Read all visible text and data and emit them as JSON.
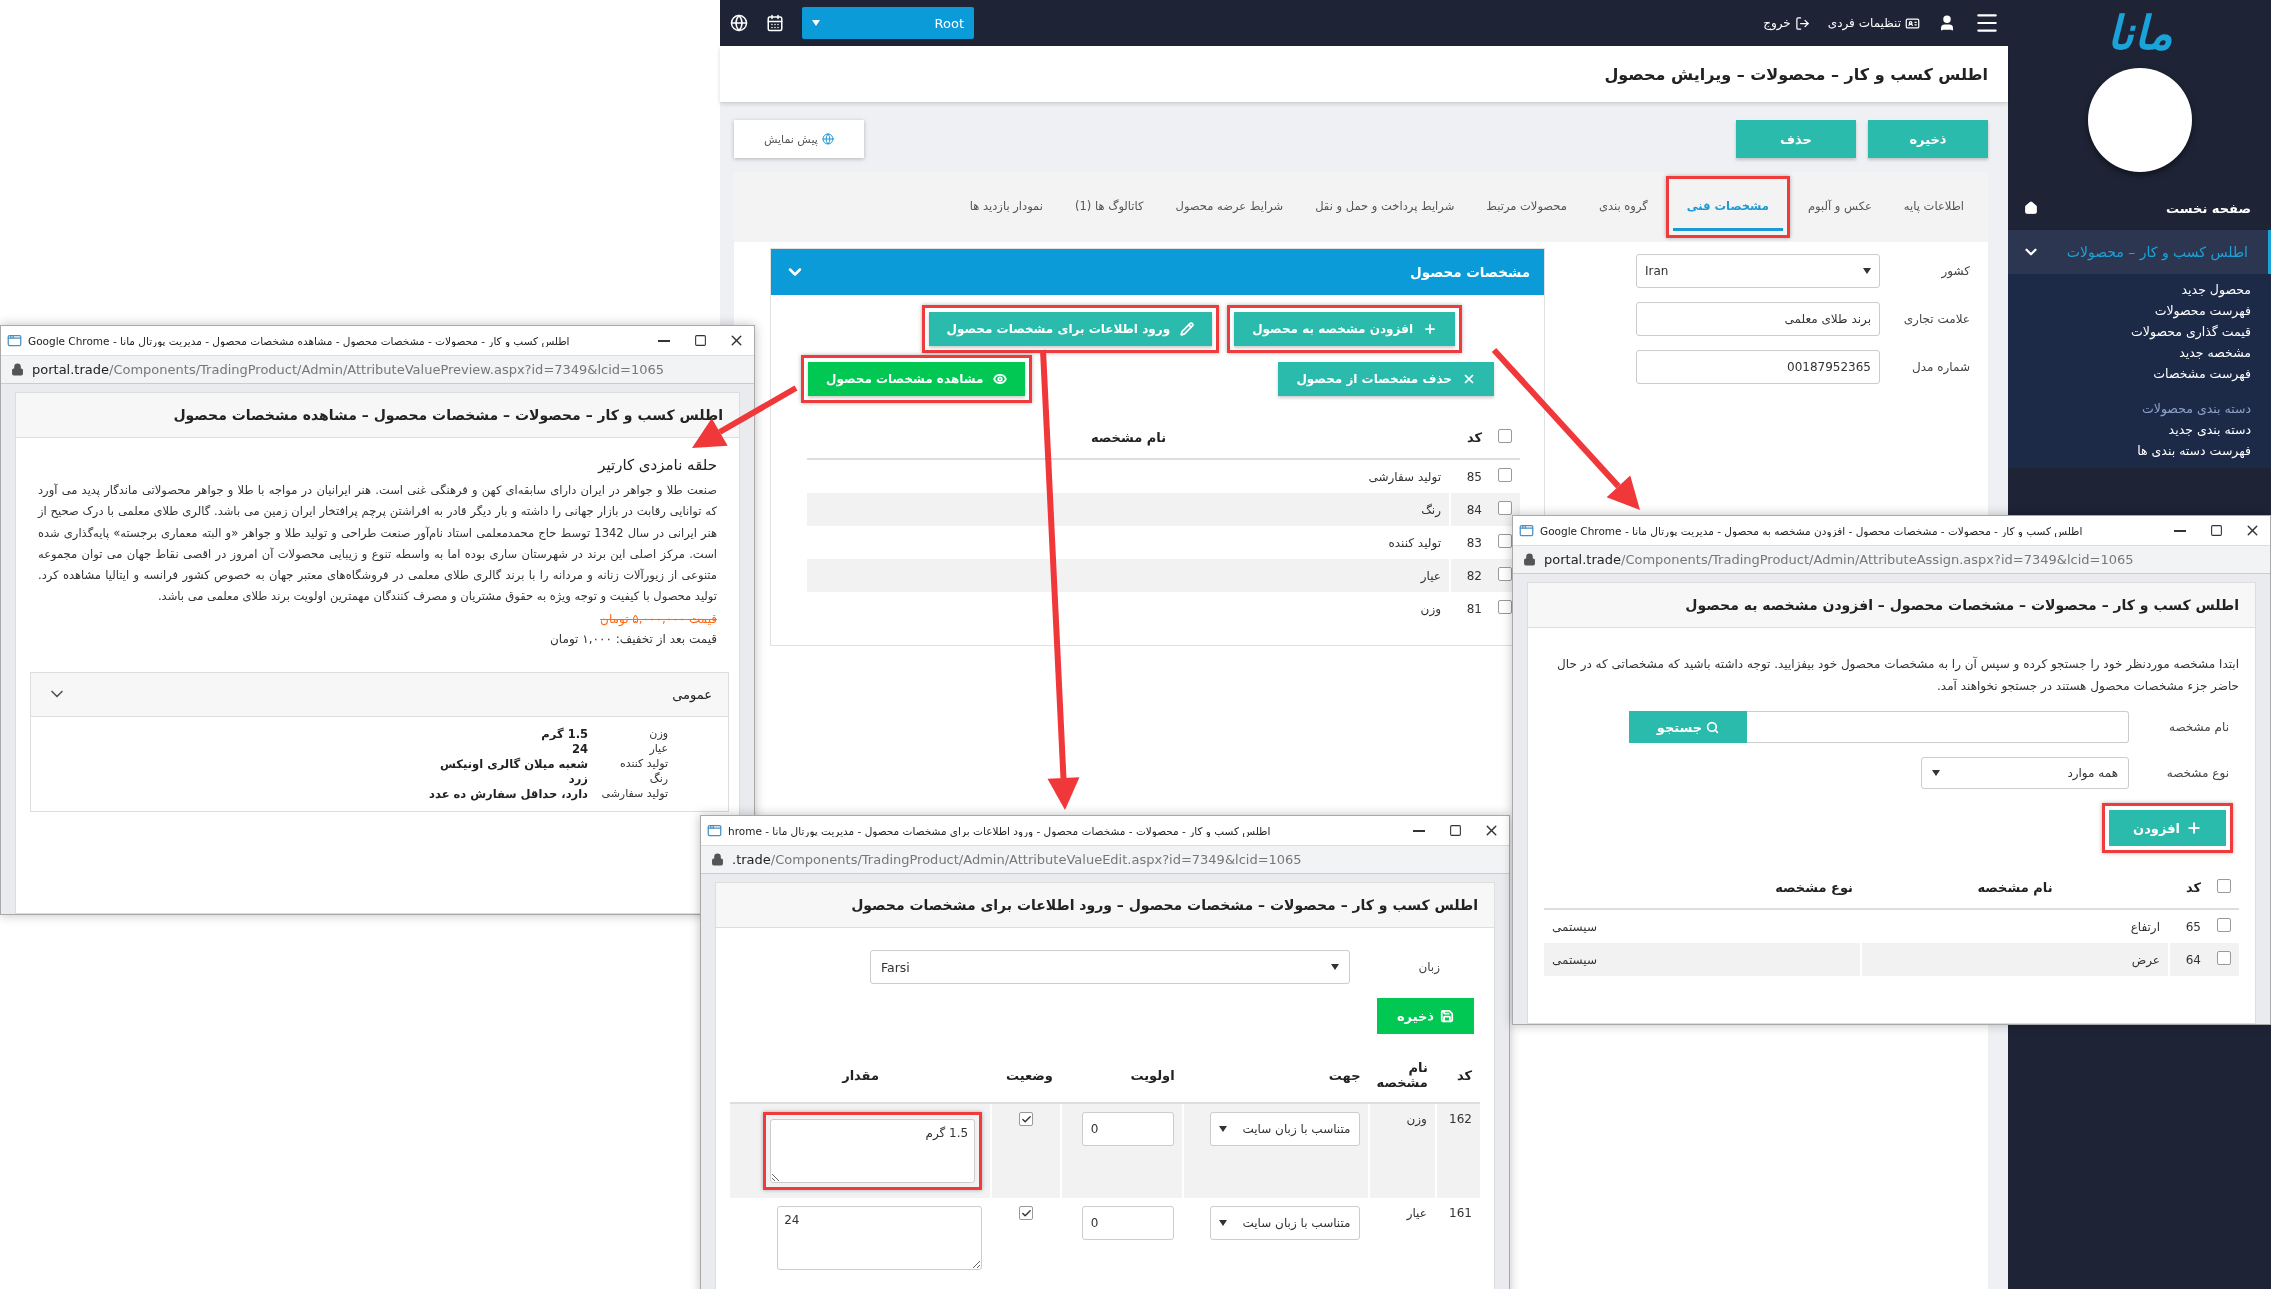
{
  "main": {
    "topbar": {
      "root_select": "Root",
      "settings": "تنظیمات فردی",
      "logout": "خروج"
    },
    "sidebar": {
      "logo": "مانا",
      "home": "صفحه نخست",
      "section": {
        "label": "اطلس کسب و کار – محصولات",
        "expanded": true
      },
      "items": [
        {
          "label": "محصول جدید",
          "kind": "link"
        },
        {
          "label": "فهرست محصولات",
          "kind": "link"
        },
        {
          "label": "قیمت گذاری محصولات",
          "kind": "link"
        },
        {
          "label": "مشخصه جدید",
          "kind": "link"
        },
        {
          "label": "فهرست مشخصات",
          "kind": "link"
        },
        {
          "label": "دسته بندی محصولات",
          "kind": "heading"
        },
        {
          "label": "دسته بندی جدید",
          "kind": "link"
        },
        {
          "label": "فهرست دسته بندی ها",
          "kind": "link"
        }
      ]
    },
    "page_title": "اطلس کسب و کار – محصولات – ویرایش محصول",
    "actions": [
      {
        "label": "ذخیره"
      },
      {
        "label": "حذف"
      }
    ],
    "preview_button": "پیش نمایش",
    "tabs": [
      {
        "label": "اطلاعات پایه",
        "selected": false,
        "highlighted": false
      },
      {
        "label": "عکس و آلبوم",
        "selected": false,
        "highlighted": false
      },
      {
        "label": "مشخصات فنی",
        "selected": true,
        "highlighted": true
      },
      {
        "label": "گروه بندی",
        "selected": false,
        "highlighted": false
      },
      {
        "label": "محصولات مرتبط",
        "selected": false,
        "highlighted": false
      },
      {
        "label": "شرایط پرداخت و حمل و نقل",
        "selected": false,
        "highlighted": false
      },
      {
        "label": "شرایط عرضه محصول",
        "selected": false,
        "highlighted": false
      },
      {
        "label": "کاتالوگ ها (1)",
        "selected": false,
        "highlighted": false
      },
      {
        "label": "نمودار بازدید ها",
        "selected": false,
        "highlighted": false
      }
    ],
    "panel": {
      "title": "مشخصات محصول",
      "expanded": true,
      "buttons": [
        {
          "label": "افزودن مشخصه به محصول",
          "kind": "add",
          "highlighted": true
        },
        {
          "label": "ورود اطلاعات برای مشخصات محصول",
          "kind": "edit",
          "highlighted": true
        },
        {
          "label": "حذف مشخصات از محصول",
          "kind": "remove",
          "highlighted": false
        },
        {
          "label": "مشاهده مشخصات محصول",
          "kind": "view",
          "highlighted": true
        }
      ],
      "table": {
        "columns": [
          "کد",
          "نام مشخصه"
        ],
        "header_checked": false,
        "rows": [
          {
            "code": "85",
            "name": "تولید سفارشی",
            "checked": false
          },
          {
            "code": "84",
            "name": "رنگ",
            "checked": false
          },
          {
            "code": "83",
            "name": "تولید کننده",
            "checked": false
          },
          {
            "code": "82",
            "name": "عیار",
            "checked": false
          },
          {
            "code": "81",
            "name": "وزن",
            "checked": false
          }
        ]
      }
    },
    "fields": [
      {
        "label": "کشور",
        "value": "Iran",
        "kind": "select"
      },
      {
        "label": "علامت تجاری",
        "value": "برند طلای معلمی",
        "kind": "text"
      },
      {
        "label": "شماره مدل",
        "value": "00187952365",
        "kind": "text"
      }
    ]
  },
  "preview_window": {
    "title": "اطلس کسب و کار - محصولات - مشخصات محصول - مشاهده مشخصات محصول - مدیریت پورتال مانا - Google Chrome",
    "url_host": "portal.trade",
    "url_path": "/Components/TradingProduct/Admin/AttributeValuePreview.aspx?id=7349&lcid=1065",
    "page_title": "اطلس کسب و کار – محصولات – مشخصات محصول – مشاهده مشخصات محصول",
    "product_title": "حلقه نامزدی کارتیر",
    "description": "صنعت طلا و جواهر در ایران دارای سابقه‌ای کهن و فرهنگی غنی است. هنر ایرانیان در مواجه با طلا و جواهر محصولاتی ماندگار پدید می آورد که توانایی رقابت در بازار جهانی را داشته و بار دیگر قادر به افراشتن پرچم پرافتخار ایران زمین می باشد. گالری طلای معلمی با درک صحیح از هنر ایرانی در سال 1342 توسط حاج محمدمعلمی استاد نام‌آور صنعت طراحی و تولید طلا و جواهر «و البته معماری برجسته» پایه‌گذاری شده است. مرکز اصلی این برند در شهرستان ساری بوده اما به واسطه تنوع و زیبایی محصولات آن امروز در اقصی نقاط جهان می توان مجموعه متنوعی از زیورآلات زنانه و مردانه را با برند گالری طلای معلمی در فروشگاه‌های معتبر جهان به خصوص کشور فرانسه و ایتالیا مشاهده کرد. تولید محصول با کیفیت و توجه ویژه به حقوق مشتریان و مصرف کنندگان مهمترین اولویت برند طلای معلمی می باشد.",
    "old_price": "قیمت ۵,۰۰۰,۰۰۰ تومان",
    "discounted_price": "قیمت بعد از تخفیف: ۱,۰۰۰ تومان",
    "accordion": {
      "title": "عمومی",
      "expanded": true,
      "rows": [
        {
          "label": "وزن",
          "value": "1.5 گرم"
        },
        {
          "label": "عیار",
          "value": "24"
        },
        {
          "label": "تولید کننده",
          "value": "شعبه میلان گالری اونیکس"
        },
        {
          "label": "رنگ",
          "value": "زرد"
        },
        {
          "label": "تولید سفارشی",
          "value": "دارد، حداقل سفارش ده عدد"
        }
      ]
    }
  },
  "assign_window": {
    "title": "اطلس کسب و کار - محصولات - مشخصات محصول - افزودن مشخصه به محصول - مدیریت پورتال مانا - Google Chrome",
    "url_host": "portal.trade",
    "url_path": "/Components/TradingProduct/Admin/AttributeAssign.aspx?id=7349&lcid=1065",
    "page_title": "اطلس کسب و کار – محصولات – مشخصات محصول – افزودن مشخصه به محصول",
    "instructions": "ابتدا مشخصه موردنظر خود را جستجو کرده و سپس آن را به مشخصات محصول خود بیفزایید. توجه داشته باشید که مشخصاتی که در حال حاضر جزء مشخصات محصول هستند در جستجو نخواهند آمد.",
    "name_label": "نام مشخصه",
    "search_button": "جستجو",
    "type_label": "نوع مشخصه",
    "type_value": "همه موارد",
    "add_button": {
      "label": "افزودن",
      "highlighted": true
    },
    "table": {
      "columns": [
        "کد",
        "نام مشخصه",
        "نوع مشخصه"
      ],
      "header_checked": false,
      "rows": [
        {
          "code": "65",
          "name": "ارتفاع",
          "type": "سیستمی",
          "checked": false
        },
        {
          "code": "64",
          "name": "عرض",
          "type": "سیستمی",
          "checked": false
        }
      ]
    }
  },
  "edit_window": {
    "title": "اطلس کسب و کار - محصولات - مشخصات محصول - ورود اطلاعات برای مشخصات محصول - مدیریت پورتال مانا - hrome",
    "url_host": ".trade",
    "url_path": "/Components/TradingProduct/Admin/AttributeValueEdit.aspx?id=7349&lcid=1065",
    "page_title": "اطلس کسب و کار – محصولات – مشخصات محصول – ورود اطلاعات برای مشخصات محصول",
    "language_label": "زبان",
    "language_value": "Farsi",
    "save_button": "ذخیره",
    "table": {
      "columns": [
        "کد",
        "نام مشخصه",
        "جهت",
        "اولویت",
        "وضعیت",
        "مقدار"
      ],
      "rows": [
        {
          "code": "162",
          "name": "وزن",
          "direction": "متناسب با زبان سایت",
          "priority": "0",
          "status": true,
          "value": "1.5 گرم",
          "highlighted": true
        },
        {
          "code": "161",
          "name": "عیار",
          "direction": "متناسب با زبان سایت",
          "priority": "0",
          "status": true,
          "value": "24",
          "highlighted": false
        }
      ]
    }
  }
}
